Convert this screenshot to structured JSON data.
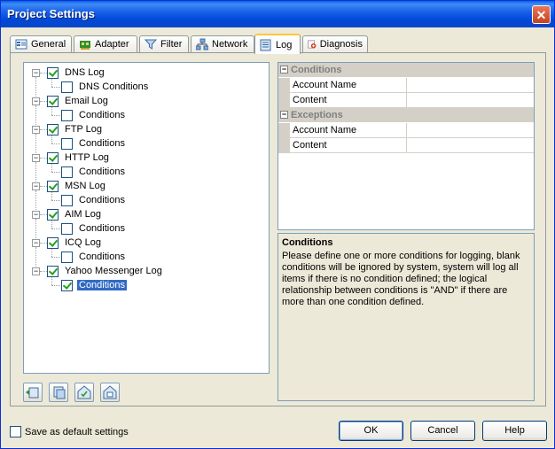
{
  "window": {
    "title": "Project Settings"
  },
  "tabs": [
    {
      "label": "General",
      "icon": "general-icon"
    },
    {
      "label": "Adapter",
      "icon": "adapter-icon"
    },
    {
      "label": "Filter",
      "icon": "filter-icon"
    },
    {
      "label": "Network",
      "icon": "network-icon"
    },
    {
      "label": "Log",
      "icon": "log-icon",
      "active": true
    },
    {
      "label": "Diagnosis",
      "icon": "diagnosis-icon"
    }
  ],
  "tree": [
    {
      "label": "DNS Log",
      "checked": true,
      "child": "DNS Conditions",
      "child_checked": false
    },
    {
      "label": "Email Log",
      "checked": true,
      "child": "Conditions",
      "child_checked": false
    },
    {
      "label": "FTP Log",
      "checked": true,
      "child": "Conditions",
      "child_checked": false
    },
    {
      "label": "HTTP Log",
      "checked": true,
      "child": "Conditions",
      "child_checked": false
    },
    {
      "label": "MSN Log",
      "checked": true,
      "child": "Conditions",
      "child_checked": false
    },
    {
      "label": "AIM Log",
      "checked": true,
      "child": "Conditions",
      "child_checked": false
    },
    {
      "label": "ICQ Log",
      "checked": true,
      "child": "Conditions",
      "child_checked": false
    },
    {
      "label": "Yahoo Messenger Log",
      "checked": true,
      "child": "Conditions",
      "child_checked": true,
      "child_selected": true
    }
  ],
  "grid": {
    "sections": [
      {
        "title": "Conditions",
        "rows": [
          {
            "name": "Account Name",
            "value": ""
          },
          {
            "name": "Content",
            "value": ""
          }
        ]
      },
      {
        "title": "Exceptions",
        "rows": [
          {
            "name": "Account Name",
            "value": ""
          },
          {
            "name": "Content",
            "value": ""
          }
        ]
      }
    ]
  },
  "description": {
    "title": "Conditions",
    "body": "Please define one or more conditions for logging, blank conditions will be ignored by system, system will log all items if there is no condition defined; the logical relationship between conditions is \"AND\" if there are more than one condition defined."
  },
  "footer": {
    "save_default_label": "Save as default settings",
    "ok_label": "OK",
    "cancel_label": "Cancel",
    "help_label": "Help"
  }
}
